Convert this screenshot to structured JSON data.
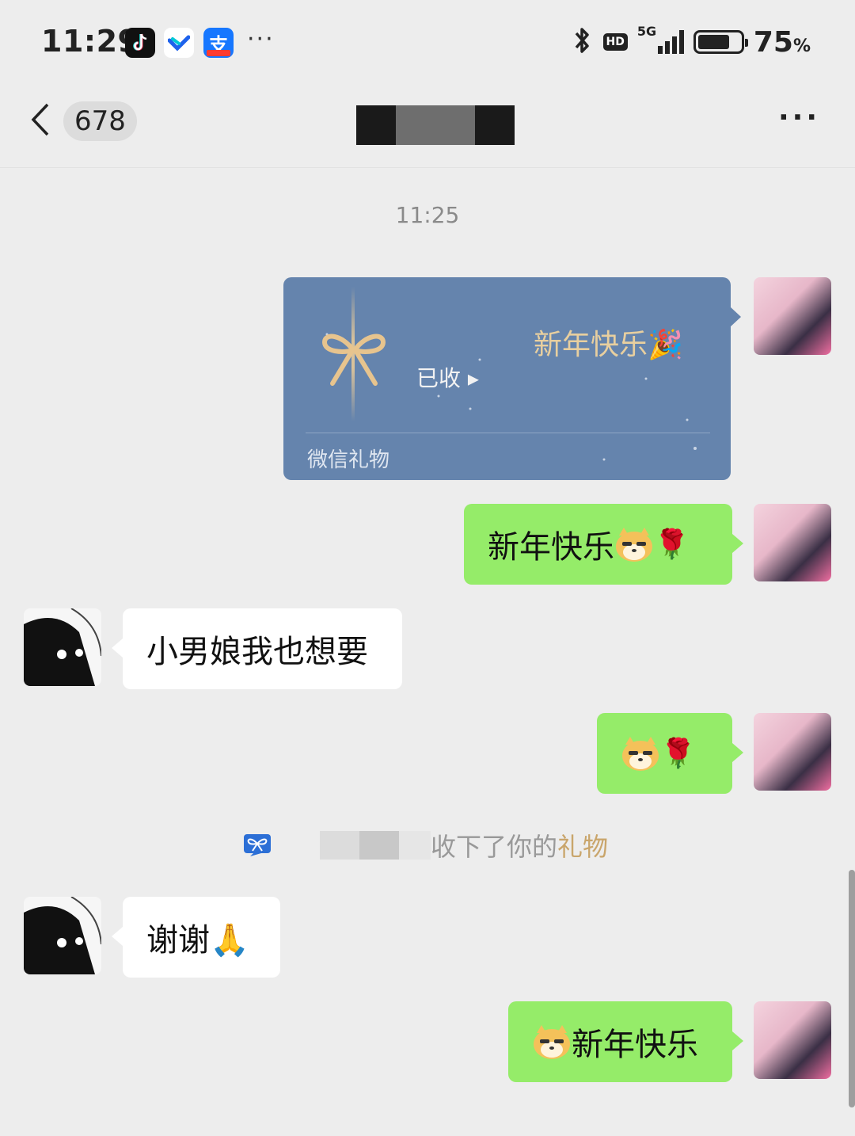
{
  "status_bar": {
    "time": "11:29",
    "notification_apps": [
      "tiktok-icon",
      "feishu-icon",
      "alipay-icon"
    ],
    "more": "···",
    "network": "5G",
    "hd": "HD",
    "battery_level": 0.75,
    "battery_value": "75",
    "battery_unit": "%"
  },
  "nav": {
    "unread_count": "678",
    "more": "···"
  },
  "chat": {
    "timestamp": "11:25",
    "gift_card": {
      "greeting": "新年快乐🎉",
      "status": "已收 ▸",
      "footer": "微信礼物"
    },
    "messages": [
      {
        "from": "me",
        "text": "新年快乐"
      },
      {
        "from": "friend",
        "text": "小男娘我也想要"
      },
      {
        "from": "me",
        "text": ""
      },
      {
        "from": "friend",
        "text": "谢谢🙏"
      },
      {
        "from": "me",
        "text": "新年快乐"
      }
    ],
    "notice": {
      "text": "收下了你的",
      "gift_word": "礼物"
    }
  },
  "colors": {
    "my_bubble": "#95ec69",
    "friend_bubble": "#ffffff",
    "gift_card": "#6584ad",
    "background": "#ededed"
  }
}
